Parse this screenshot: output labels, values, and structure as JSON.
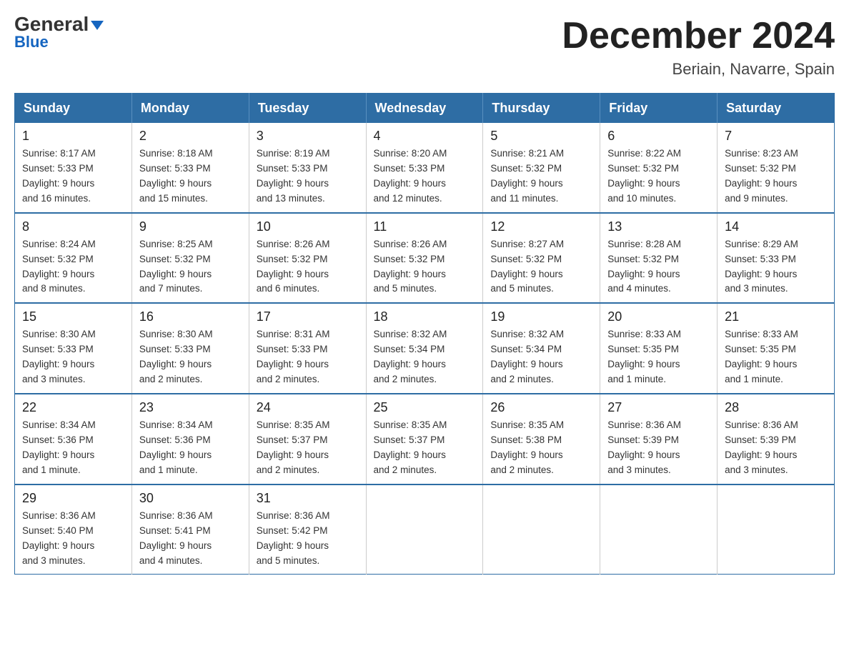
{
  "logo": {
    "general": "General",
    "blue": "Blue"
  },
  "header": {
    "month_title": "December 2024",
    "location": "Beriain, Navarre, Spain"
  },
  "days_of_week": [
    "Sunday",
    "Monday",
    "Tuesday",
    "Wednesday",
    "Thursday",
    "Friday",
    "Saturday"
  ],
  "weeks": [
    [
      {
        "day": "1",
        "sunrise": "8:17 AM",
        "sunset": "5:33 PM",
        "daylight": "9 hours and 16 minutes."
      },
      {
        "day": "2",
        "sunrise": "8:18 AM",
        "sunset": "5:33 PM",
        "daylight": "9 hours and 15 minutes."
      },
      {
        "day": "3",
        "sunrise": "8:19 AM",
        "sunset": "5:33 PM",
        "daylight": "9 hours and 13 minutes."
      },
      {
        "day": "4",
        "sunrise": "8:20 AM",
        "sunset": "5:33 PM",
        "daylight": "9 hours and 12 minutes."
      },
      {
        "day": "5",
        "sunrise": "8:21 AM",
        "sunset": "5:32 PM",
        "daylight": "9 hours and 11 minutes."
      },
      {
        "day": "6",
        "sunrise": "8:22 AM",
        "sunset": "5:32 PM",
        "daylight": "9 hours and 10 minutes."
      },
      {
        "day": "7",
        "sunrise": "8:23 AM",
        "sunset": "5:32 PM",
        "daylight": "9 hours and 9 minutes."
      }
    ],
    [
      {
        "day": "8",
        "sunrise": "8:24 AM",
        "sunset": "5:32 PM",
        "daylight": "9 hours and 8 minutes."
      },
      {
        "day": "9",
        "sunrise": "8:25 AM",
        "sunset": "5:32 PM",
        "daylight": "9 hours and 7 minutes."
      },
      {
        "day": "10",
        "sunrise": "8:26 AM",
        "sunset": "5:32 PM",
        "daylight": "9 hours and 6 minutes."
      },
      {
        "day": "11",
        "sunrise": "8:26 AM",
        "sunset": "5:32 PM",
        "daylight": "9 hours and 5 minutes."
      },
      {
        "day": "12",
        "sunrise": "8:27 AM",
        "sunset": "5:32 PM",
        "daylight": "9 hours and 5 minutes."
      },
      {
        "day": "13",
        "sunrise": "8:28 AM",
        "sunset": "5:32 PM",
        "daylight": "9 hours and 4 minutes."
      },
      {
        "day": "14",
        "sunrise": "8:29 AM",
        "sunset": "5:33 PM",
        "daylight": "9 hours and 3 minutes."
      }
    ],
    [
      {
        "day": "15",
        "sunrise": "8:30 AM",
        "sunset": "5:33 PM",
        "daylight": "9 hours and 3 minutes."
      },
      {
        "day": "16",
        "sunrise": "8:30 AM",
        "sunset": "5:33 PM",
        "daylight": "9 hours and 2 minutes."
      },
      {
        "day": "17",
        "sunrise": "8:31 AM",
        "sunset": "5:33 PM",
        "daylight": "9 hours and 2 minutes."
      },
      {
        "day": "18",
        "sunrise": "8:32 AM",
        "sunset": "5:34 PM",
        "daylight": "9 hours and 2 minutes."
      },
      {
        "day": "19",
        "sunrise": "8:32 AM",
        "sunset": "5:34 PM",
        "daylight": "9 hours and 2 minutes."
      },
      {
        "day": "20",
        "sunrise": "8:33 AM",
        "sunset": "5:35 PM",
        "daylight": "9 hours and 1 minute."
      },
      {
        "day": "21",
        "sunrise": "8:33 AM",
        "sunset": "5:35 PM",
        "daylight": "9 hours and 1 minute."
      }
    ],
    [
      {
        "day": "22",
        "sunrise": "8:34 AM",
        "sunset": "5:36 PM",
        "daylight": "9 hours and 1 minute."
      },
      {
        "day": "23",
        "sunrise": "8:34 AM",
        "sunset": "5:36 PM",
        "daylight": "9 hours and 1 minute."
      },
      {
        "day": "24",
        "sunrise": "8:35 AM",
        "sunset": "5:37 PM",
        "daylight": "9 hours and 2 minutes."
      },
      {
        "day": "25",
        "sunrise": "8:35 AM",
        "sunset": "5:37 PM",
        "daylight": "9 hours and 2 minutes."
      },
      {
        "day": "26",
        "sunrise": "8:35 AM",
        "sunset": "5:38 PM",
        "daylight": "9 hours and 2 minutes."
      },
      {
        "day": "27",
        "sunrise": "8:36 AM",
        "sunset": "5:39 PM",
        "daylight": "9 hours and 3 minutes."
      },
      {
        "day": "28",
        "sunrise": "8:36 AM",
        "sunset": "5:39 PM",
        "daylight": "9 hours and 3 minutes."
      }
    ],
    [
      {
        "day": "29",
        "sunrise": "8:36 AM",
        "sunset": "5:40 PM",
        "daylight": "9 hours and 3 minutes."
      },
      {
        "day": "30",
        "sunrise": "8:36 AM",
        "sunset": "5:41 PM",
        "daylight": "9 hours and 4 minutes."
      },
      {
        "day": "31",
        "sunrise": "8:36 AM",
        "sunset": "5:42 PM",
        "daylight": "9 hours and 5 minutes."
      },
      null,
      null,
      null,
      null
    ]
  ],
  "labels": {
    "sunrise": "Sunrise:",
    "sunset": "Sunset:",
    "daylight": "Daylight:"
  }
}
